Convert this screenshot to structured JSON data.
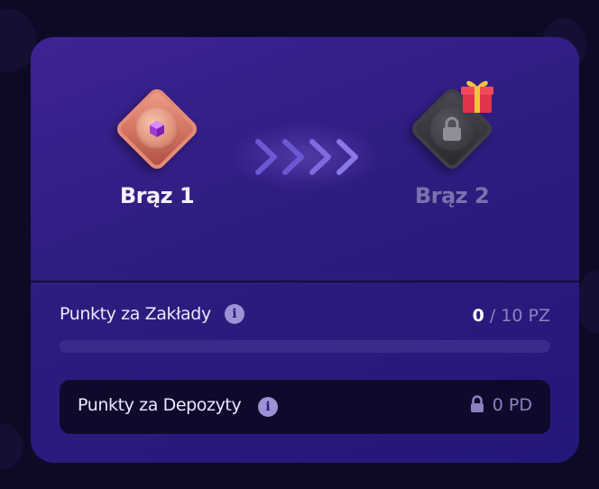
{
  "levels": {
    "current": {
      "label": "Brąz 1",
      "icon": "bronze-gem-badge"
    },
    "next": {
      "label": "Brąz 2",
      "icon": "locked-badge",
      "reward_icon": "gift-icon"
    }
  },
  "arrows_icon": "chevrons-right",
  "bets": {
    "label": "Punkty za Zakłady",
    "info_icon": "i",
    "current": "0",
    "target": "/ 10 PZ",
    "progress": 0
  },
  "deposits": {
    "label": "Punkty za Depozyty",
    "info_icon": "i",
    "value": "0 PD",
    "locked": true
  },
  "colors": {
    "card_bg": "#2d1c7e",
    "bronze": "#d1705d",
    "progress_fill": "#b8a8ff",
    "muted_text": "#8b83c0"
  }
}
